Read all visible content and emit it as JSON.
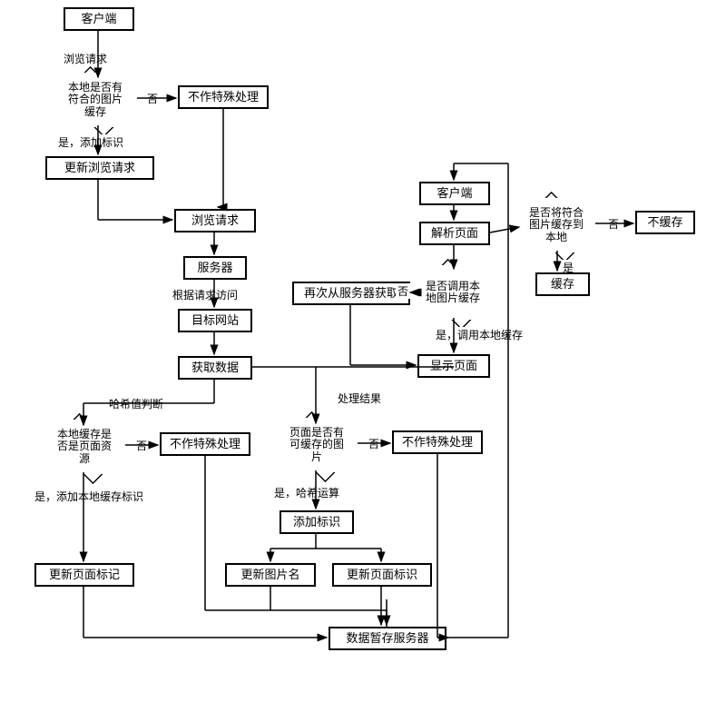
{
  "nodes": {
    "n_client_top": "客户端",
    "n_browse_req_lbl": "浏览请求",
    "d_has_local": "本地是否有\n符合的图片\n缓存",
    "n_no_special_1": "不作特殊处理",
    "lbl_no_1": "否",
    "lbl_yes_add": "是，添加标识",
    "n_update_req": "更新浏览请求",
    "n_browse_req_box": "浏览请求",
    "n_server": "服务器",
    "lbl_by_req": "根据请求访问",
    "n_target_site": "目标网站",
    "n_get_data": "获取数据",
    "lbl_hash_judge": "哈希值判断",
    "d_is_page_res": "本地缓存是\n否是页面资\n源",
    "n_no_special_2": "不作特殊处理",
    "lbl_no_2": "否",
    "lbl_yes_add_local": "是，添加本地缓存标识",
    "n_update_page_mark": "更新页面标记",
    "lbl_proc_result": "处理结果",
    "d_has_cacheable": "页面是否有\n可缓存的图\n片",
    "n_no_special_3": "不作特殊处理",
    "lbl_no_3": "否",
    "lbl_yes_hash": "是，哈希运算",
    "n_add_mark": "添加标识",
    "n_update_img_name": "更新图片名",
    "n_update_page_id": "更新页面标识",
    "n_data_cache_srv": "数据暂存服务器",
    "n_client_right": "客户端",
    "n_parse_page": "解析页面",
    "d_save_to_local": "是否将符合\n图片缓存到\n本地",
    "n_no_cache": "不缓存",
    "n_cache": "缓存",
    "lbl_no_4": "否",
    "lbl_yes_4": "是",
    "d_use_local": "是否调用本\n地图片缓存",
    "n_retry_server": "再次从服务器获取",
    "lbl_no_5": "否",
    "lbl_yes_use": "是，调用本地缓存",
    "n_show_page": "显示页面"
  }
}
